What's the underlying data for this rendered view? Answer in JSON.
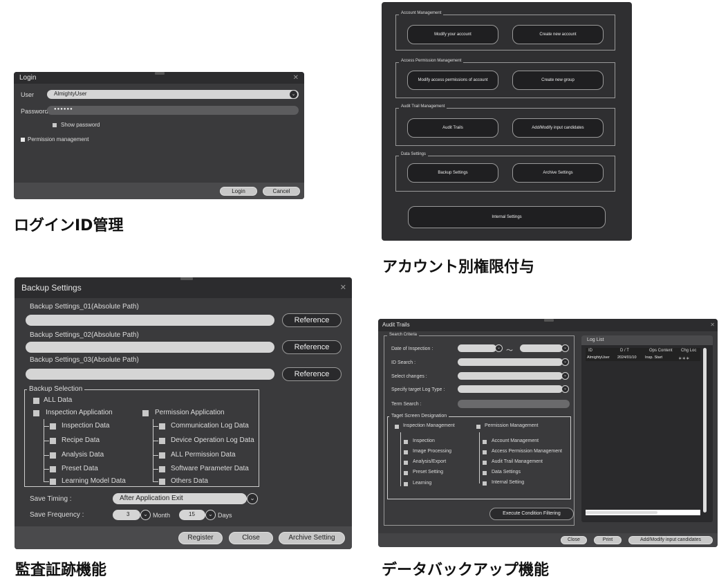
{
  "login": {
    "title": "Login",
    "user_label": "User",
    "user_value": "AlmightyUser",
    "password_label": "Password",
    "password_value": "●●●●●●",
    "show_password": "Show password",
    "permission_management": "Permission management",
    "login_button": "Login",
    "cancel_button": "Cancel",
    "caption": "ログインID管理"
  },
  "account": {
    "groups": [
      {
        "title": "Account Management",
        "buttons": [
          "Modify your account",
          "Create new account"
        ]
      },
      {
        "title": "Access Permission Management",
        "buttons": [
          "Modify access permissions of account",
          "Create new group"
        ]
      },
      {
        "title": "Audit Trail Management",
        "buttons": [
          "Audit Trails",
          "Add/Modify input candidates"
        ]
      },
      {
        "title": "Data Settings",
        "buttons": [
          "Backup Settings",
          "Archive Settings"
        ]
      }
    ],
    "internal_settings": "Internal Settings",
    "caption": "アカウント別権限付与"
  },
  "backup": {
    "title": "Backup Settings",
    "paths": [
      {
        "label": "Backup Settings_01(Absolute Path)",
        "value": ""
      },
      {
        "label": "Backup Settings_02(Absolute Path)",
        "value": ""
      },
      {
        "label": "Backup Settings_03(Absolute Path)",
        "value": ""
      }
    ],
    "reference_button": "Reference",
    "selection_title": "Backup Selection",
    "all_data": "ALL Data",
    "inspection_application": "Inspection Application",
    "permission_application": "Permission Application",
    "inspection_items": [
      "Inspection Data",
      "Recipe Data",
      "Analysis Data",
      "Preset Data",
      "Learning Model Data"
    ],
    "permission_items": [
      "Communication Log Data",
      "Device Operation Log Data",
      "ALL Permission Data",
      "Software Parameter Data",
      "Others Data"
    ],
    "save_timing_label": "Save Timing :",
    "save_timing_value": "After Application Exit",
    "save_frequency_label": "Save Frequency :",
    "month_value": "3",
    "month_label": "Month",
    "days_value": "15",
    "days_label": "Days",
    "register_button": "Register",
    "close_button": "Close",
    "archive_button": "Archive Setting",
    "caption": "監査証跡機能"
  },
  "audit": {
    "title": "Audit Trails",
    "search_criteria": "Search Criteria",
    "date_label": "Date of Inspection :",
    "tilde": "～",
    "id_label": "ID Search :",
    "select_changes_label": "Select changes :",
    "log_type_label": "Specify target Log Type :",
    "term_label": "Term Search :",
    "target_screen": "Taget Screen Designation",
    "inspection_management": "Inspection Management",
    "permission_management": "Permission Management",
    "inspection_items": [
      "Inspection",
      "Image Processing",
      "Analysis/Export",
      "Preset Setting",
      "Learning"
    ],
    "permission_items": [
      "Account Management",
      "Access Permission Management",
      "Audit Trail Management",
      "Data Settings",
      "Internal Setting"
    ],
    "execute_button": "Execute Condition Filtering",
    "log_list_title": "Log List",
    "log_columns": [
      "ID",
      "D / T",
      "Ops Content",
      "Chg Loc"
    ],
    "log_rows": [
      [
        "AlmightyUser",
        "2024/01/10",
        "Insp. Start",
        "＊＊＊"
      ]
    ],
    "close_button": "Close",
    "print_button": "Print",
    "add_modify_button": "Add/Modify input candidates",
    "caption": "データバックアップ機能"
  }
}
